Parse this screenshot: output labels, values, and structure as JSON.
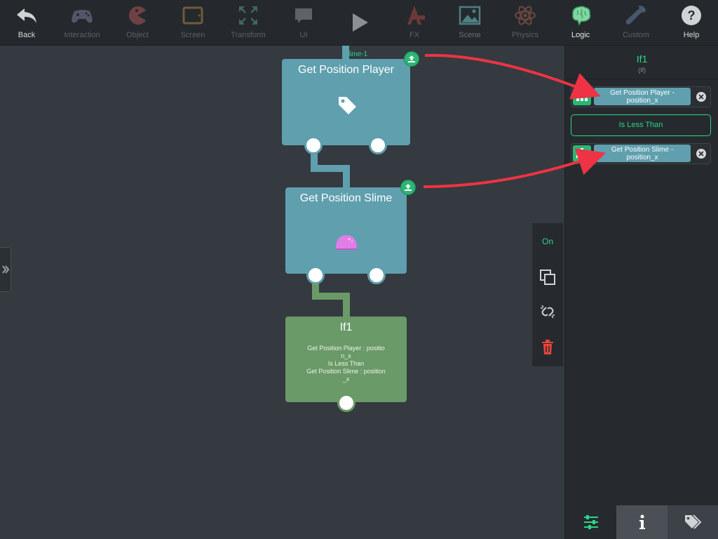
{
  "toolbar": {
    "items": [
      {
        "label": "Back",
        "icon": "back-arrow-icon"
      },
      {
        "label": "Interaction",
        "icon": "gamepad-icon"
      },
      {
        "label": "Object",
        "icon": "pacman-icon"
      },
      {
        "label": "Screen",
        "icon": "tablet-icon"
      },
      {
        "label": "Transform",
        "icon": "expand-arrows-icon"
      },
      {
        "label": "UI",
        "icon": "speech-bubble-icon"
      },
      {
        "label": "",
        "icon": "play-icon"
      },
      {
        "label": "FX",
        "icon": "fx-icon"
      },
      {
        "label": "Scene",
        "icon": "landscape-image-icon"
      },
      {
        "label": "Physics",
        "icon": "atom-icon"
      },
      {
        "label": "Logic",
        "icon": "brain-icon"
      },
      {
        "label": "Custom",
        "icon": "wrench-icon"
      },
      {
        "label": "Help",
        "icon": "help-icon"
      }
    ]
  },
  "canvas": {
    "parent_label": "lime-1",
    "nodes": {
      "get_position_player": {
        "title": "Get Position Player",
        "icon": "tag-icon"
      },
      "get_position_slime": {
        "title": "Get Position Slime",
        "icon": "slime-icon"
      },
      "if1": {
        "title": "If1",
        "condition_lines": [
          "Get Position Player : positio",
          "n_x",
          "Is Less Than",
          "Get Position Slime : position",
          "_x"
        ]
      }
    }
  },
  "context_bar": {
    "toggle_label": "On"
  },
  "panel": {
    "title": "If1",
    "subtitle": "(If)",
    "left_operand": {
      "line1": "Get Position Player -",
      "line2": "position_x"
    },
    "operator": "Is Less Than",
    "right_operand": {
      "line1": "Get Position Slime -",
      "line2": "position_x"
    }
  },
  "colors": {
    "accent_green": "#2bd68a",
    "node_teal": "#5f9fae",
    "node_green": "#6a9a67",
    "arrow_red": "#ee3344"
  }
}
